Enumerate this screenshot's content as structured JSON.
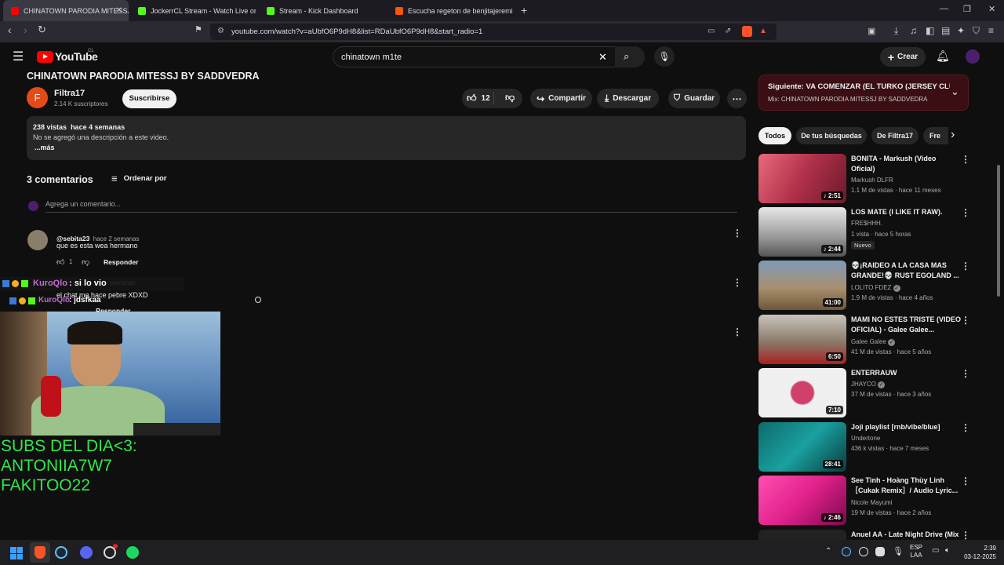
{
  "browser": {
    "tabs": [
      {
        "label": "CHINATOWN PARODIA MITESSJ",
        "color": "#ff0000"
      },
      {
        "label": "JockerrCL Stream - Watch Live on Kic",
        "color": "#53fc18"
      },
      {
        "label": "Stream - Kick Dashboard",
        "color": "#53fc18"
      },
      {
        "label": "Escucha regeton de benjitajeremias |",
        "color": "#ff5500"
      }
    ],
    "url": "youtube.com/watch?v=aUbfO6P9dH8&list=RDaUbfO6P9dH8&start_radio=1"
  },
  "youtube": {
    "logo_text": "YouTube",
    "logo_region": "CL",
    "search_value": "chinatown m1te",
    "create_label": "Crear"
  },
  "video": {
    "title": "CHINATOWN PARODIA MITESSJ BY SADDVEDRA",
    "channel_name": "Filtra17",
    "channel_initial": "F",
    "subscribers": "2.14 K suscriptores",
    "subscribe_label": "Suscribirse",
    "likes": "12",
    "share_label": "Compartir",
    "download_label": "Descargar",
    "save_label": "Guardar",
    "views": "238 vistas",
    "date": "hace 4 semanas",
    "description": "No se agregó una descripción a este video.",
    "more_label": "...más"
  },
  "comments": {
    "count_label": "3 comentarios",
    "sort_label": "Ordenar por",
    "add_placeholder": "Agrega un comentario...",
    "items": [
      {
        "author": "@sebita23",
        "time": "hace 2 semanas",
        "text": "que es esta wea hermano",
        "likes": "1",
        "reply": "Responder"
      },
      {
        "author": "",
        "time": "semanas",
        "text": "el chat me hace pebre XDXD",
        "likes": "",
        "reply": "Responder"
      }
    ]
  },
  "stream_overlay": {
    "chat": [
      {
        "user": "KuroQlo",
        "msg": ": si lo vio"
      },
      {
        "user": "KuroQlo",
        "msg": ": jdsfkaa"
      }
    ],
    "subs_title": "SUBS DEL DIA<3:",
    "subs": [
      "ANTONIIA7W7",
      "FAKITOO22"
    ]
  },
  "sidebar": {
    "next_label": "Siguiente: VA COMENZAR (EL TURKO (JERSEY CLU...",
    "mix_label": "Mix: CHINATOWN PARODIA MITESSJ BY SADDVEDRA",
    "chips": [
      "Todos",
      "De tus búsquedas",
      "De Filtra17",
      "Fre"
    ],
    "videos": [
      {
        "title": "BONITA - Markush (Video Oficial)",
        "channel": "Markush DLFR",
        "stats": "1.1 M de vistas · hace 11 meses",
        "duration": "2:51",
        "verified": false,
        "badge": ""
      },
      {
        "title": "LOS MATE (I LIKE IT RAW).",
        "channel": "FRE$HHH.",
        "stats": "1 vista · hace 5 horas",
        "duration": "2:44",
        "verified": false,
        "badge": "Nuevo"
      },
      {
        "title": "💀¡RAIDEO A LA CASA MAS GRANDE!💀 RUST EGOLAND ...",
        "channel": "LOLITO FDEZ",
        "stats": "1.9 M de vistas · hace 4 años",
        "duration": "41:00",
        "verified": true,
        "badge": ""
      },
      {
        "title": "MAMI NO ESTES TRISTE (VIDEO OFICIAL) - Galee Galee...",
        "channel": "Galee Galee",
        "stats": "41 M de vistas · hace 5 años",
        "duration": "6:50",
        "verified": true,
        "badge": ""
      },
      {
        "title": "ENTERRAUW",
        "channel": "JHAYCO",
        "stats": "37 M de vistas · hace 3 años",
        "duration": "7:10",
        "verified": true,
        "badge": ""
      },
      {
        "title": "Joji playlist [rnb/vibe/blue]",
        "channel": "Undertone",
        "stats": "436 k vistas · hace 7 meses",
        "duration": "28:41",
        "verified": false,
        "badge": ""
      },
      {
        "title": "See Tình - Hoàng Thùy Linh ［Cukak Remix］/ Audio Lyric...",
        "channel": "Nicole Mayumi",
        "stats": "19 M de vistas · hace 2 años",
        "duration": "2:46",
        "verified": false,
        "badge": ""
      },
      {
        "title": "Anuel AA - Late Night Drive (Mix",
        "channel": "",
        "stats": "",
        "duration": "",
        "verified": false,
        "badge": ""
      }
    ]
  },
  "taskbar": {
    "lang": "ESP",
    "layout": "LAA",
    "time": "2:39",
    "date": "03-12-2025"
  },
  "colors": {
    "bg": "#0f0f0f",
    "mix_panel": "#3a0e12",
    "overlay_green": "#2fe84a",
    "chat_user": "#c46ad8"
  }
}
